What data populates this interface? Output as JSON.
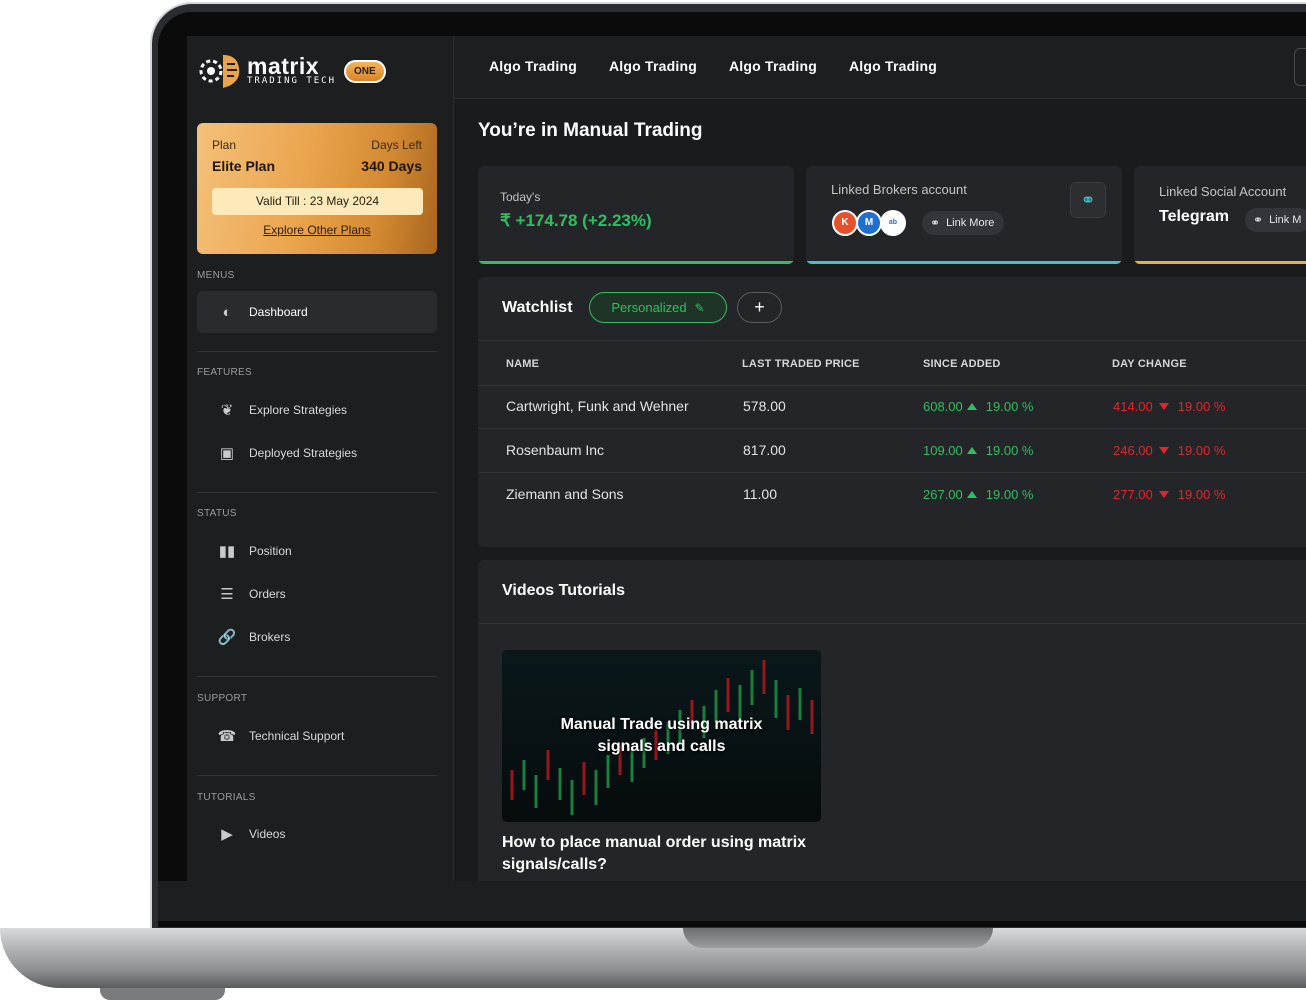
{
  "brand": {
    "name": "matrix",
    "tagline": "TRADING TECH",
    "badge": "ONE"
  },
  "plan": {
    "plan_label": "Plan",
    "plan_name": "Elite Plan",
    "days_label": "Days Left",
    "days_value": "340 Days",
    "valid_till": "Valid Till : 23 May 2024",
    "explore_link": "Explore Other Plans"
  },
  "sidebar": {
    "menus_title": "MENUS",
    "dashboard": "Dashboard",
    "features_title": "FEATURES",
    "explore_strategies": "Explore Strategies",
    "deployed_strategies": "Deployed Strategies",
    "status_title": "STATUS",
    "position": "Position",
    "orders": "Orders",
    "brokers": "Brokers",
    "support_title": "SUPPORT",
    "technical_support": "Technical Support",
    "tutorials_title": "TUTORIALS",
    "videos": "Videos"
  },
  "topnav": {
    "tabs": [
      "Algo Trading",
      "Algo Trading",
      "Algo Trading",
      "Algo Trading"
    ]
  },
  "page": {
    "title": "You’re in Manual Trading"
  },
  "cards": {
    "today_label": "Today's",
    "today_value": "₹ +174.78 (+2.23%)",
    "brokers_label": "Linked Brokers account",
    "brokers_link": "Link More",
    "social_label": "Linked Social Account",
    "social_value": "Telegram",
    "social_link": "Link M"
  },
  "watchlist": {
    "title": "Watchlist",
    "filter": "Personalized",
    "add": "+",
    "columns": {
      "name": "NAME",
      "ltp": "LAST TRADED PRICE",
      "since": "SINCE ADDED",
      "day": "DAY CHANGE"
    },
    "rows": [
      {
        "name": "Cartwright, Funk and Wehner",
        "ltp": "578.00",
        "since_val": "608.00",
        "since_pct": "19.00 %",
        "day_val": "414.00",
        "day_pct": "19.00 %"
      },
      {
        "name": "Rosenbaum Inc",
        "ltp": "817.00",
        "since_val": "109.00",
        "since_pct": "19.00 %",
        "day_val": "246.00",
        "day_pct": "19.00 %"
      },
      {
        "name": "Ziemann and Sons",
        "ltp": "11.00",
        "since_val": "267.00",
        "since_pct": "19.00 %",
        "day_val": "277.00",
        "day_pct": "19.00 %"
      }
    ]
  },
  "tutorials": {
    "title": "Videos Tutorials",
    "thumb_title_1": "Manual Trade using matrix",
    "thumb_title_2": "signals and calls",
    "caption": "How to place manual order using matrix signals/calls?"
  },
  "colors": {
    "green": "#2fbf62",
    "red": "#e0262d",
    "teal": "#3fc1d6",
    "gold": "#e2b53a",
    "plan_gold": "#eaa44e"
  }
}
